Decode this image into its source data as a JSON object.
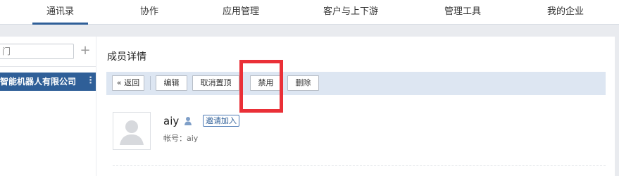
{
  "nav": {
    "tabs": [
      {
        "label": "通讯录"
      },
      {
        "label": "协作"
      },
      {
        "label": "应用管理"
      },
      {
        "label": "客户与上下游"
      },
      {
        "label": "管理工具"
      },
      {
        "label": "我的企业"
      }
    ],
    "active_tab": "通讯录"
  },
  "sidebar": {
    "search_value": "门",
    "add_symbol": "+",
    "org_name": "智能机器人有限公司",
    "more_symbol": "⋮"
  },
  "member": {
    "section_title": "成员详情",
    "toolbar": {
      "back": "« 返回",
      "edit": "编辑",
      "unpin": "取消置顶",
      "disable": "禁用",
      "delete": "删除"
    },
    "name": "aiy",
    "invite_label": "邀请加入",
    "account_label": "帐号：aiy"
  },
  "colors": {
    "accent": "#2f5f98",
    "toolbar_bg": "#dde6f2",
    "highlight": "#ea3037"
  }
}
